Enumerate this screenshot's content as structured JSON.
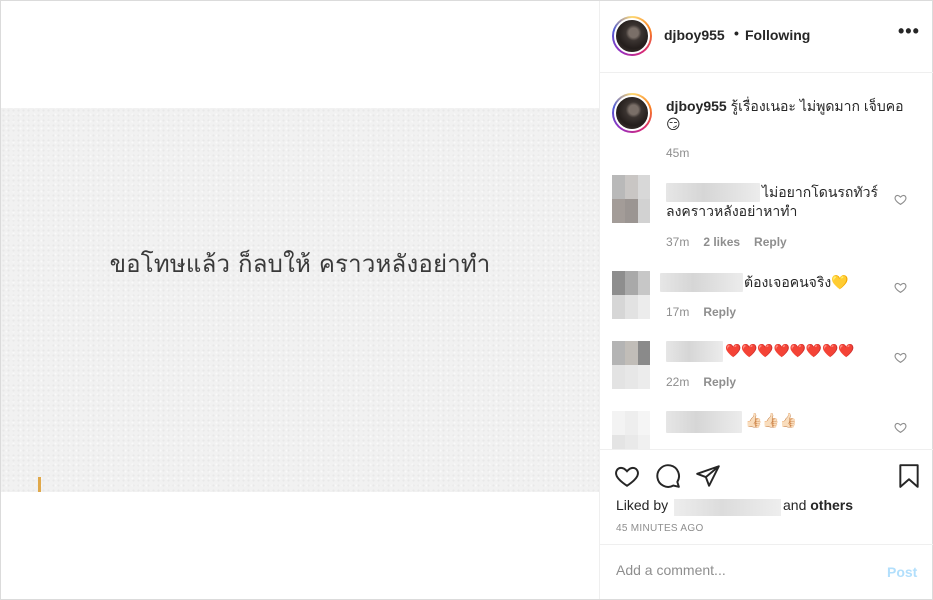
{
  "post_image": {
    "text": "ขอโทษแล้ว ก็ลบให้ คราวหลังอย่าทำ"
  },
  "header": {
    "username": "djboy955",
    "separator": "•",
    "follow_status": "Following",
    "more_label": "•••"
  },
  "caption": {
    "username": "djboy955",
    "text": "รู้เรื่องเนอะ ไม่พูดมาก เจ็บคอ 😏",
    "time": "45m"
  },
  "comments": [
    {
      "text": "ไม่อยากโดนรถทัวร์ลงคราวหลังอย่าหาทำ",
      "time": "37m",
      "likes": "2 likes",
      "reply": "Reply"
    },
    {
      "text": "ต้องเจอคนจริง💛",
      "time": "17m",
      "likes": "",
      "reply": "Reply"
    },
    {
      "text": "❤️❤️❤️❤️❤️❤️❤️❤️",
      "time": "22m",
      "likes": "",
      "reply": "Reply"
    },
    {
      "text": "👍🏻👍🏻👍🏻",
      "time": "",
      "likes": "",
      "reply": ""
    }
  ],
  "actions": {
    "liked_by_prefix": "Liked by",
    "and_label": "and",
    "others_label": "others",
    "time_ago": "45 MINUTES AGO"
  },
  "add_comment": {
    "placeholder": "Add a comment...",
    "post_label": "Post"
  },
  "colors": {
    "post_button": "#b2dffc",
    "muted": "#8e8e8e",
    "text": "#262626"
  }
}
